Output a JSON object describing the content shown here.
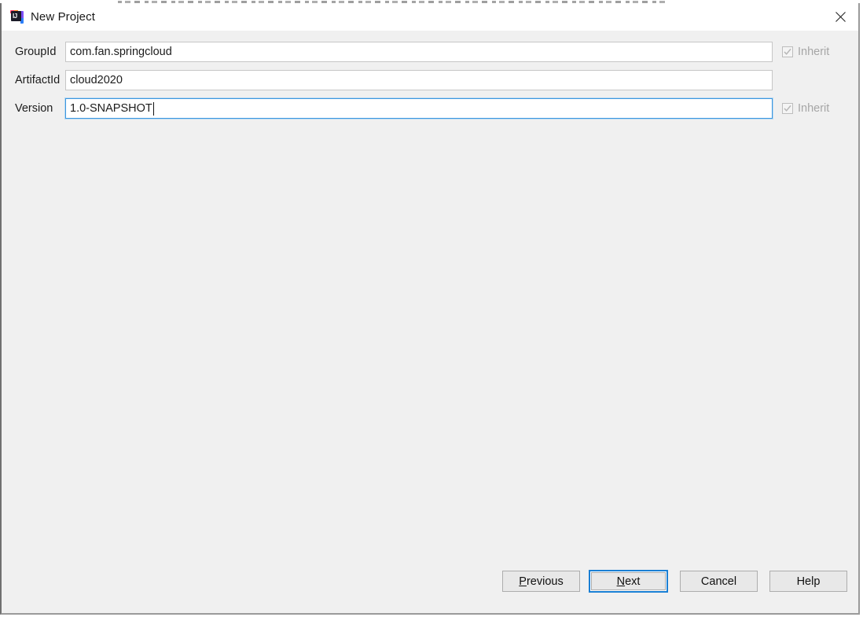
{
  "window": {
    "title": "New Project",
    "app_icon": "intellij-idea-icon",
    "close_icon": "close-icon"
  },
  "form": {
    "fields": [
      {
        "label": "GroupId",
        "value": "com.fan.springcloud",
        "focused": false,
        "has_inherit": true,
        "inherit_label": "Inherit",
        "inherit_checked": true,
        "inherit_disabled": true
      },
      {
        "label": "ArtifactId",
        "value": "cloud2020",
        "focused": false,
        "has_inherit": false
      },
      {
        "label": "Version",
        "value": "1.0-SNAPSHOT",
        "focused": true,
        "has_inherit": true,
        "inherit_label": "Inherit",
        "inherit_checked": true,
        "inherit_disabled": true
      }
    ]
  },
  "footer": {
    "buttons": [
      {
        "label": "Previous",
        "mnemonic": "P",
        "before": "",
        "after": "revious",
        "default": false
      },
      {
        "label": "Next",
        "mnemonic": "N",
        "before": "",
        "after": "ext",
        "default": true
      },
      {
        "label": "Cancel",
        "mnemonic": "",
        "before": "Cancel",
        "after": "",
        "default": false
      },
      {
        "label": "Help",
        "mnemonic": "",
        "before": "Help",
        "after": "",
        "default": false
      }
    ]
  },
  "colors": {
    "accent_focus": "#1a7fd4",
    "field_focus_border": "#3d97de",
    "dialog_bg": "#f0f0f0",
    "titlebar_bg": "#ffffff",
    "text": "#1c1c1c",
    "disabled_text": "#a6a6a6"
  }
}
